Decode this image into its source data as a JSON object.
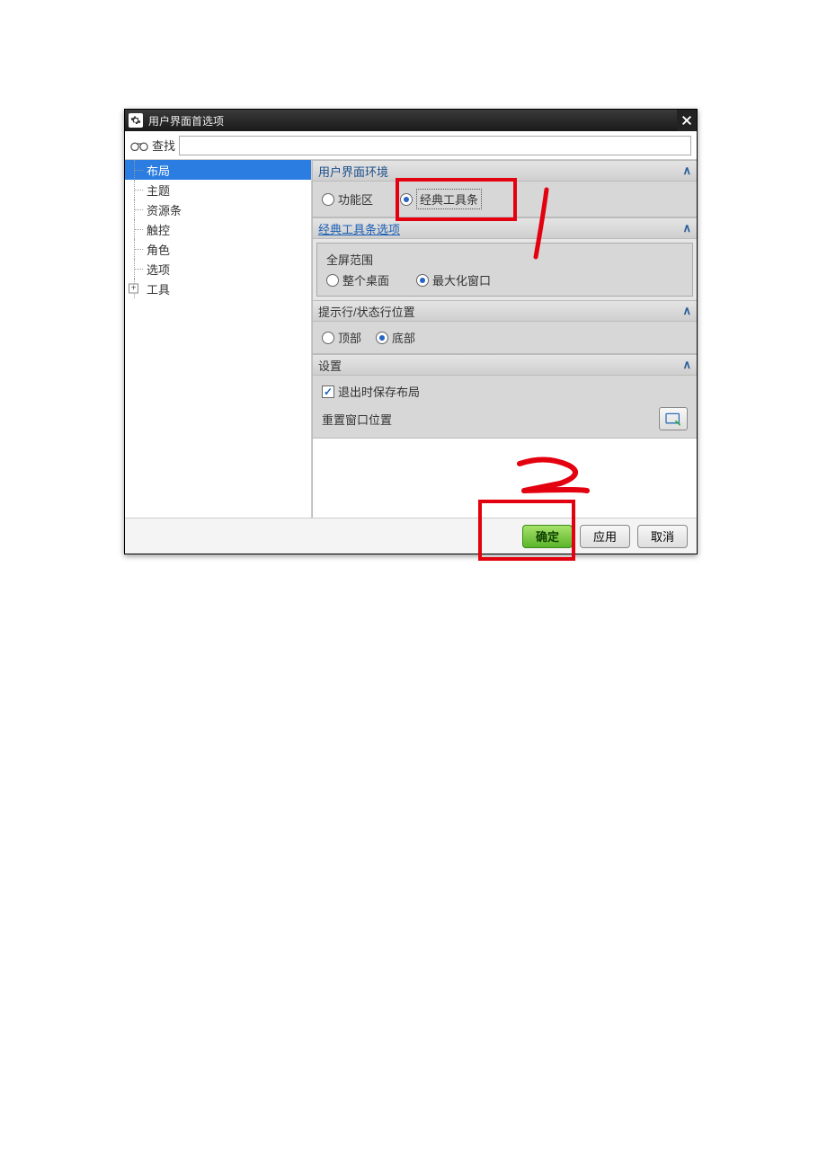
{
  "title": "用户界面首选项",
  "search": {
    "label": "查找",
    "value": ""
  },
  "tree": {
    "items": [
      "布局",
      "主题",
      "资源条",
      "触控",
      "角色",
      "选项",
      "工具"
    ],
    "selected": 0,
    "expandable": [
      6
    ]
  },
  "sections": {
    "env": {
      "title": "用户界面环境",
      "opt1": "功能区",
      "opt2": "经典工具条",
      "selected": "opt2"
    },
    "classic": {
      "title": "经典工具条选项",
      "group": "全屏范围",
      "opt1": "整个桌面",
      "opt2": "最大化窗口",
      "selected": "opt2"
    },
    "status": {
      "title": "提示行/状态行位置",
      "opt1": "顶部",
      "opt2": "底部",
      "selected": "opt2"
    },
    "settings": {
      "title": "设置",
      "check1": "退出时保存布局",
      "check1_checked": true,
      "reset_label": "重置窗口位置"
    }
  },
  "footer": {
    "ok": "确定",
    "apply": "应用",
    "cancel": "取消"
  }
}
